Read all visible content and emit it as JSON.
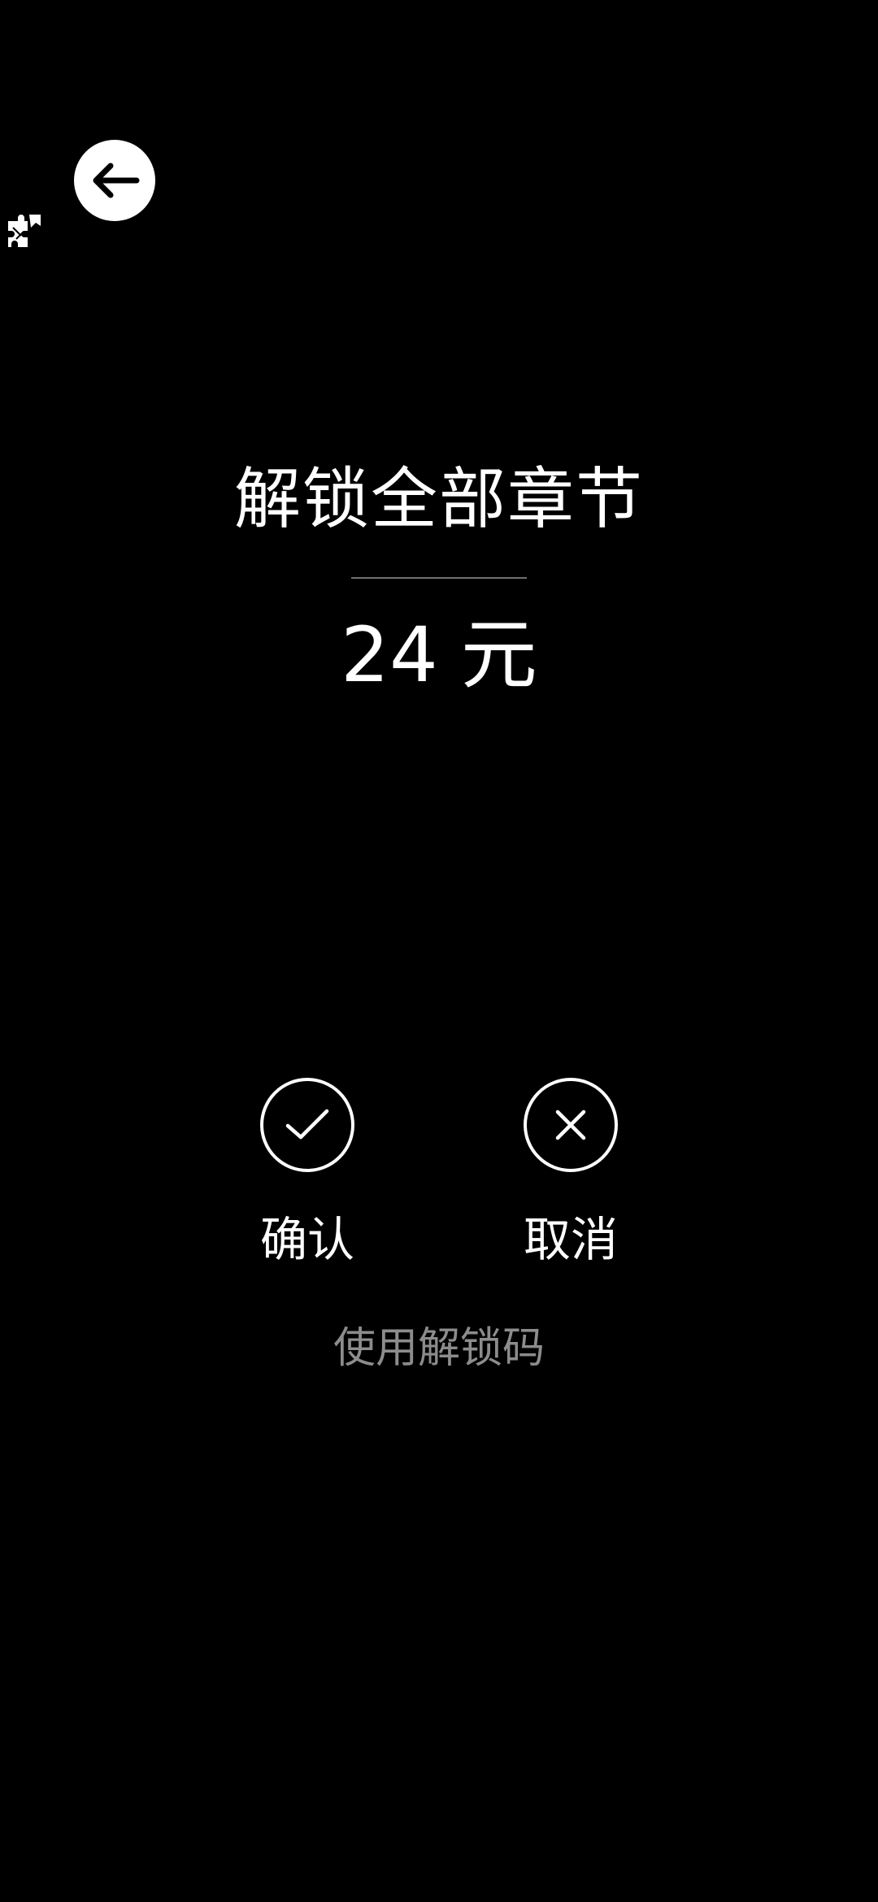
{
  "header": {
    "back_icon": "arrow-left-icon",
    "plugin_icon": "puzzle-icon"
  },
  "dialog": {
    "title": "解锁全部章节",
    "price_amount": "24",
    "price_unit": "元",
    "confirm_label": "确认",
    "confirm_icon": "check-icon",
    "cancel_label": "取消",
    "cancel_icon": "x-icon",
    "unlock_code_label": "使用解锁码"
  },
  "colors": {
    "background": "#000000",
    "foreground": "#ffffff",
    "muted": "#8c8c8c"
  }
}
